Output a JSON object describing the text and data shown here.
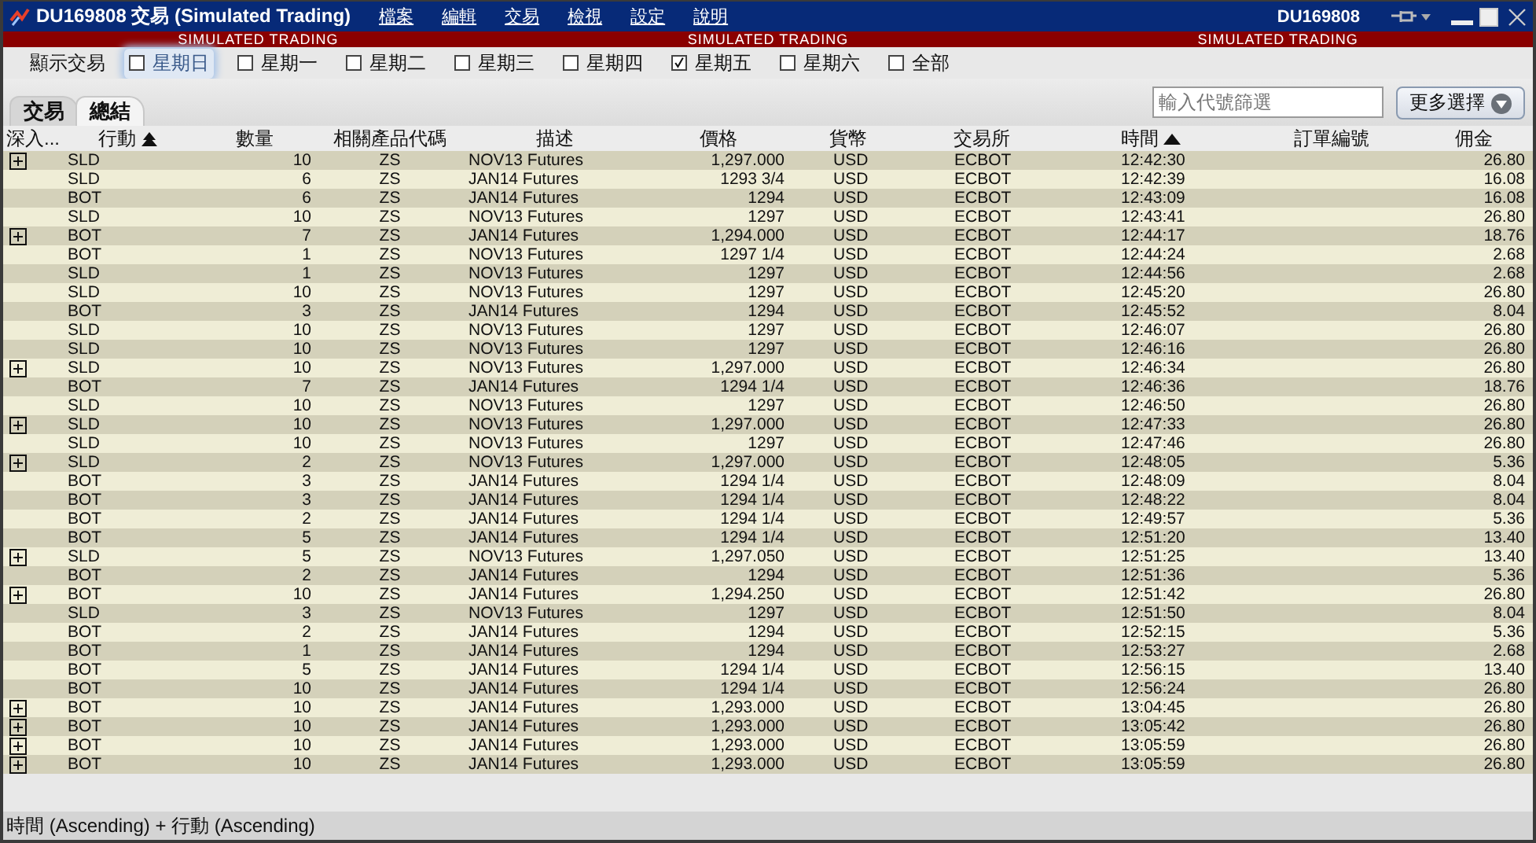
{
  "window": {
    "title": "DU169808 交易 (Simulated Trading)",
    "menus": [
      "檔案",
      "編輯",
      "交易",
      "檢視",
      "設定",
      "說明"
    ],
    "account": "DU169808"
  },
  "banner": [
    "SIMULATED TRADING",
    "SIMULATED TRADING",
    "SIMULATED TRADING"
  ],
  "filter": {
    "label": "顯示交易",
    "days": [
      {
        "label": "星期日",
        "checked": false,
        "focused": true
      },
      {
        "label": "星期一",
        "checked": false,
        "focused": false
      },
      {
        "label": "星期二",
        "checked": false,
        "focused": false
      },
      {
        "label": "星期三",
        "checked": false,
        "focused": false
      },
      {
        "label": "星期四",
        "checked": false,
        "focused": false
      },
      {
        "label": "星期五",
        "checked": true,
        "focused": false
      },
      {
        "label": "星期六",
        "checked": false,
        "focused": false
      },
      {
        "label": "全部",
        "checked": false,
        "focused": false
      }
    ]
  },
  "tabs": [
    {
      "label": "交易",
      "selected": false
    },
    {
      "label": "總結",
      "selected": true
    }
  ],
  "search": {
    "placeholder": "輸入代號篩選"
  },
  "more_button": "更多選擇",
  "table": {
    "columns": [
      {
        "label": "深入...",
        "kind": "plain"
      },
      {
        "label": "行動",
        "kind": "secondary"
      },
      {
        "label": "數量",
        "kind": "plain"
      },
      {
        "label": "相關產品代碼",
        "kind": "plain"
      },
      {
        "label": "描述",
        "kind": "plain"
      },
      {
        "label": "價格",
        "kind": "plain"
      },
      {
        "label": "貨幣",
        "kind": "plain"
      },
      {
        "label": "交易所",
        "kind": "plain"
      },
      {
        "label": "時間",
        "kind": "primary"
      },
      {
        "label": "訂單編號",
        "kind": "plain"
      },
      {
        "label": "佣金",
        "kind": "plain"
      }
    ],
    "rows": [
      {
        "expandable": true,
        "action": "SLD",
        "qty": "10",
        "symbol": "ZS",
        "desc": "NOV13 Futures",
        "price": "1,297.000",
        "currency": "USD",
        "exchange": "ECBOT",
        "time": "12:42:30",
        "commission": "26.80"
      },
      {
        "expandable": false,
        "action": "SLD",
        "qty": "6",
        "symbol": "ZS",
        "desc": "JAN14 Futures",
        "price": "1293 3/4",
        "currency": "USD",
        "exchange": "ECBOT",
        "time": "12:42:39",
        "commission": "16.08"
      },
      {
        "expandable": false,
        "action": "BOT",
        "qty": "6",
        "symbol": "ZS",
        "desc": "JAN14 Futures",
        "price": "1294",
        "currency": "USD",
        "exchange": "ECBOT",
        "time": "12:43:09",
        "commission": "16.08"
      },
      {
        "expandable": false,
        "action": "SLD",
        "qty": "10",
        "symbol": "ZS",
        "desc": "NOV13 Futures",
        "price": "1297",
        "currency": "USD",
        "exchange": "ECBOT",
        "time": "12:43:41",
        "commission": "26.80"
      },
      {
        "expandable": true,
        "action": "BOT",
        "qty": "7",
        "symbol": "ZS",
        "desc": "JAN14 Futures",
        "price": "1,294.000",
        "currency": "USD",
        "exchange": "ECBOT",
        "time": "12:44:17",
        "commission": "18.76"
      },
      {
        "expandable": false,
        "action": "BOT",
        "qty": "1",
        "symbol": "ZS",
        "desc": "NOV13 Futures",
        "price": "1297 1/4",
        "currency": "USD",
        "exchange": "ECBOT",
        "time": "12:44:24",
        "commission": "2.68"
      },
      {
        "expandable": false,
        "action": "SLD",
        "qty": "1",
        "symbol": "ZS",
        "desc": "NOV13 Futures",
        "price": "1297",
        "currency": "USD",
        "exchange": "ECBOT",
        "time": "12:44:56",
        "commission": "2.68"
      },
      {
        "expandable": false,
        "action": "SLD",
        "qty": "10",
        "symbol": "ZS",
        "desc": "NOV13 Futures",
        "price": "1297",
        "currency": "USD",
        "exchange": "ECBOT",
        "time": "12:45:20",
        "commission": "26.80"
      },
      {
        "expandable": false,
        "action": "BOT",
        "qty": "3",
        "symbol": "ZS",
        "desc": "JAN14 Futures",
        "price": "1294",
        "currency": "USD",
        "exchange": "ECBOT",
        "time": "12:45:52",
        "commission": "8.04"
      },
      {
        "expandable": false,
        "action": "SLD",
        "qty": "10",
        "symbol": "ZS",
        "desc": "NOV13 Futures",
        "price": "1297",
        "currency": "USD",
        "exchange": "ECBOT",
        "time": "12:46:07",
        "commission": "26.80"
      },
      {
        "expandable": false,
        "action": "SLD",
        "qty": "10",
        "symbol": "ZS",
        "desc": "NOV13 Futures",
        "price": "1297",
        "currency": "USD",
        "exchange": "ECBOT",
        "time": "12:46:16",
        "commission": "26.80"
      },
      {
        "expandable": true,
        "action": "SLD",
        "qty": "10",
        "symbol": "ZS",
        "desc": "NOV13 Futures",
        "price": "1,297.000",
        "currency": "USD",
        "exchange": "ECBOT",
        "time": "12:46:34",
        "commission": "26.80"
      },
      {
        "expandable": false,
        "action": "BOT",
        "qty": "7",
        "symbol": "ZS",
        "desc": "JAN14 Futures",
        "price": "1294 1/4",
        "currency": "USD",
        "exchange": "ECBOT",
        "time": "12:46:36",
        "commission": "18.76"
      },
      {
        "expandable": false,
        "action": "SLD",
        "qty": "10",
        "symbol": "ZS",
        "desc": "NOV13 Futures",
        "price": "1297",
        "currency": "USD",
        "exchange": "ECBOT",
        "time": "12:46:50",
        "commission": "26.80"
      },
      {
        "expandable": true,
        "action": "SLD",
        "qty": "10",
        "symbol": "ZS",
        "desc": "NOV13 Futures",
        "price": "1,297.000",
        "currency": "USD",
        "exchange": "ECBOT",
        "time": "12:47:33",
        "commission": "26.80"
      },
      {
        "expandable": false,
        "action": "SLD",
        "qty": "10",
        "symbol": "ZS",
        "desc": "NOV13 Futures",
        "price": "1297",
        "currency": "USD",
        "exchange": "ECBOT",
        "time": "12:47:46",
        "commission": "26.80"
      },
      {
        "expandable": true,
        "action": "SLD",
        "qty": "2",
        "symbol": "ZS",
        "desc": "NOV13 Futures",
        "price": "1,297.000",
        "currency": "USD",
        "exchange": "ECBOT",
        "time": "12:48:05",
        "commission": "5.36"
      },
      {
        "expandable": false,
        "action": "BOT",
        "qty": "3",
        "symbol": "ZS",
        "desc": "JAN14 Futures",
        "price": "1294 1/4",
        "currency": "USD",
        "exchange": "ECBOT",
        "time": "12:48:09",
        "commission": "8.04"
      },
      {
        "expandable": false,
        "action": "BOT",
        "qty": "3",
        "symbol": "ZS",
        "desc": "JAN14 Futures",
        "price": "1294 1/4",
        "currency": "USD",
        "exchange": "ECBOT",
        "time": "12:48:22",
        "commission": "8.04"
      },
      {
        "expandable": false,
        "action": "BOT",
        "qty": "2",
        "symbol": "ZS",
        "desc": "JAN14 Futures",
        "price": "1294 1/4",
        "currency": "USD",
        "exchange": "ECBOT",
        "time": "12:49:57",
        "commission": "5.36"
      },
      {
        "expandable": false,
        "action": "BOT",
        "qty": "5",
        "symbol": "ZS",
        "desc": "JAN14 Futures",
        "price": "1294 1/4",
        "currency": "USD",
        "exchange": "ECBOT",
        "time": "12:51:20",
        "commission": "13.40"
      },
      {
        "expandable": true,
        "action": "SLD",
        "qty": "5",
        "symbol": "ZS",
        "desc": "NOV13 Futures",
        "price": "1,297.050",
        "currency": "USD",
        "exchange": "ECBOT",
        "time": "12:51:25",
        "commission": "13.40"
      },
      {
        "expandable": false,
        "action": "BOT",
        "qty": "2",
        "symbol": "ZS",
        "desc": "JAN14 Futures",
        "price": "1294",
        "currency": "USD",
        "exchange": "ECBOT",
        "time": "12:51:36",
        "commission": "5.36"
      },
      {
        "expandable": true,
        "action": "BOT",
        "qty": "10",
        "symbol": "ZS",
        "desc": "JAN14 Futures",
        "price": "1,294.250",
        "currency": "USD",
        "exchange": "ECBOT",
        "time": "12:51:42",
        "commission": "26.80"
      },
      {
        "expandable": false,
        "action": "SLD",
        "qty": "3",
        "symbol": "ZS",
        "desc": "NOV13 Futures",
        "price": "1297",
        "currency": "USD",
        "exchange": "ECBOT",
        "time": "12:51:50",
        "commission": "8.04"
      },
      {
        "expandable": false,
        "action": "BOT",
        "qty": "2",
        "symbol": "ZS",
        "desc": "JAN14 Futures",
        "price": "1294",
        "currency": "USD",
        "exchange": "ECBOT",
        "time": "12:52:15",
        "commission": "5.36"
      },
      {
        "expandable": false,
        "action": "BOT",
        "qty": "1",
        "symbol": "ZS",
        "desc": "JAN14 Futures",
        "price": "1294",
        "currency": "USD",
        "exchange": "ECBOT",
        "time": "12:53:27",
        "commission": "2.68"
      },
      {
        "expandable": false,
        "action": "BOT",
        "qty": "5",
        "symbol": "ZS",
        "desc": "JAN14 Futures",
        "price": "1294 1/4",
        "currency": "USD",
        "exchange": "ECBOT",
        "time": "12:56:15",
        "commission": "13.40"
      },
      {
        "expandable": false,
        "action": "BOT",
        "qty": "10",
        "symbol": "ZS",
        "desc": "JAN14 Futures",
        "price": "1294 1/4",
        "currency": "USD",
        "exchange": "ECBOT",
        "time": "12:56:24",
        "commission": "26.80"
      },
      {
        "expandable": true,
        "action": "BOT",
        "qty": "10",
        "symbol": "ZS",
        "desc": "JAN14 Futures",
        "price": "1,293.000",
        "currency": "USD",
        "exchange": "ECBOT",
        "time": "13:04:45",
        "commission": "26.80"
      },
      {
        "expandable": true,
        "action": "BOT",
        "qty": "10",
        "symbol": "ZS",
        "desc": "JAN14 Futures",
        "price": "1,293.000",
        "currency": "USD",
        "exchange": "ECBOT",
        "time": "13:05:42",
        "commission": "26.80"
      },
      {
        "expandable": true,
        "action": "BOT",
        "qty": "10",
        "symbol": "ZS",
        "desc": "JAN14 Futures",
        "price": "1,293.000",
        "currency": "USD",
        "exchange": "ECBOT",
        "time": "13:05:59",
        "commission": "26.80"
      },
      {
        "expandable": true,
        "action": "BOT",
        "qty": "10",
        "symbol": "ZS",
        "desc": "JAN14 Futures",
        "price": "1,293.000",
        "currency": "USD",
        "exchange": "ECBOT",
        "time": "13:05:59",
        "commission": "26.80"
      }
    ]
  },
  "status_bar": "時間 (Ascending) + 行動 (Ascending)"
}
